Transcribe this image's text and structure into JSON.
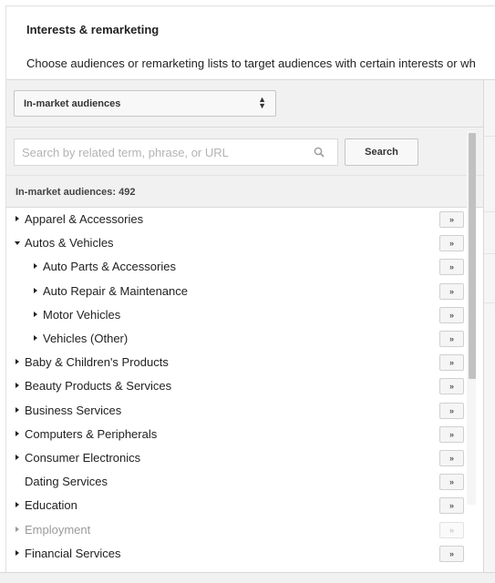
{
  "header": {
    "title": "Interests & remarketing",
    "description": "Choose audiences or remarketing lists to target audiences with certain interests or wh"
  },
  "audience_select": {
    "selected": "In-market audiences"
  },
  "search": {
    "placeholder": "Search by related term, phrase, or URL",
    "value": "",
    "button_label": "Search"
  },
  "count_label": "In-market audiences: 492",
  "add_button_label": "»",
  "items": [
    {
      "label": "Apparel & Accessories",
      "expand": "collapsed",
      "level": 0,
      "disabled": false
    },
    {
      "label": "Autos & Vehicles",
      "expand": "expanded",
      "level": 0,
      "disabled": false
    },
    {
      "label": "Auto Parts & Accessories",
      "expand": "collapsed",
      "level": 1,
      "disabled": false
    },
    {
      "label": "Auto Repair & Maintenance",
      "expand": "collapsed",
      "level": 1,
      "disabled": false
    },
    {
      "label": "Motor Vehicles",
      "expand": "collapsed",
      "level": 1,
      "disabled": false
    },
    {
      "label": "Vehicles (Other)",
      "expand": "collapsed",
      "level": 1,
      "disabled": false
    },
    {
      "label": "Baby & Children's Products",
      "expand": "collapsed",
      "level": 0,
      "disabled": false
    },
    {
      "label": "Beauty Products & Services",
      "expand": "collapsed",
      "level": 0,
      "disabled": false
    },
    {
      "label": "Business Services",
      "expand": "collapsed",
      "level": 0,
      "disabled": false
    },
    {
      "label": "Computers & Peripherals",
      "expand": "collapsed",
      "level": 0,
      "disabled": false
    },
    {
      "label": "Consumer Electronics",
      "expand": "collapsed",
      "level": 0,
      "disabled": false
    },
    {
      "label": "Dating Services",
      "expand": "none",
      "level": 0,
      "disabled": false
    },
    {
      "label": "Education",
      "expand": "collapsed",
      "level": 0,
      "disabled": false
    },
    {
      "label": "Employment",
      "expand": "collapsed",
      "level": 0,
      "disabled": true
    },
    {
      "label": "Financial Services",
      "expand": "collapsed",
      "level": 0,
      "disabled": false
    }
  ],
  "icons": {
    "select_arrows": "up-down-chevron-icon",
    "search": "magnifier-icon",
    "expand_collapsed": "triangle-right-icon",
    "expand_expanded": "triangle-down-icon"
  },
  "colors": {
    "panel_bg": "#f1f1f1",
    "border": "#d9d9d9",
    "text": "#222222",
    "disabled_text": "#9a9a9a",
    "scroll_thumb": "#c1c1c1"
  }
}
